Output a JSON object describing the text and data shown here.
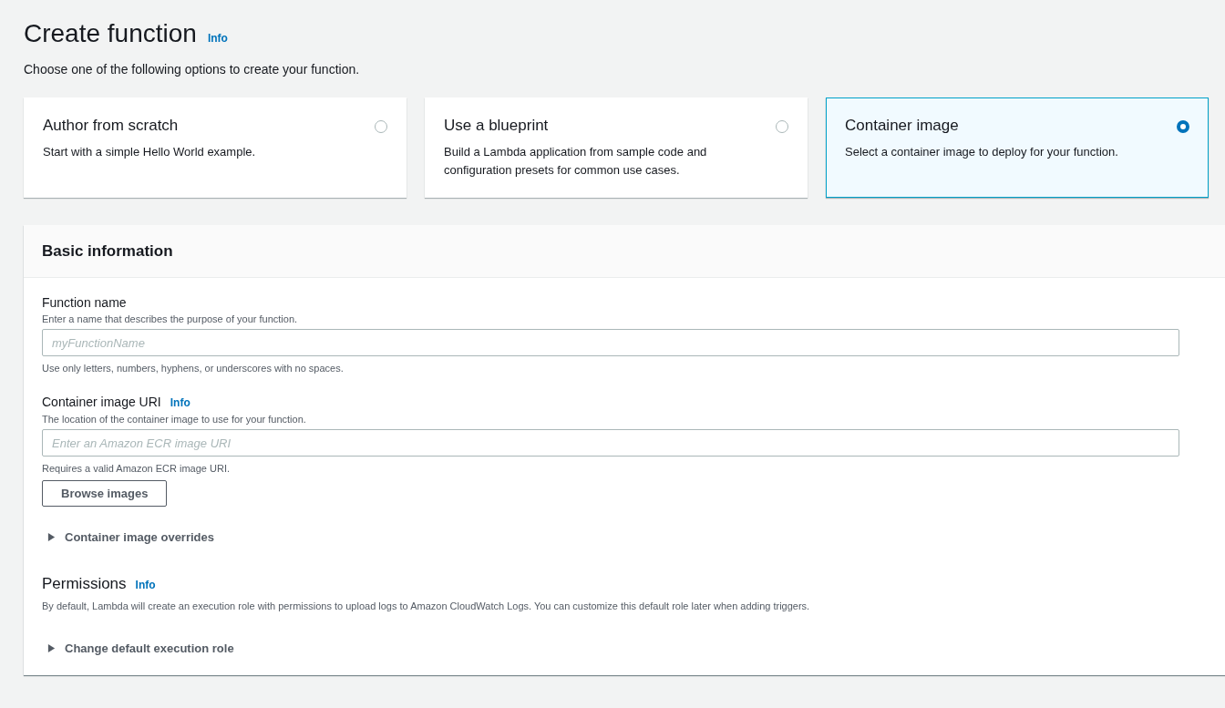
{
  "header": {
    "title": "Create function",
    "info_link": "Info",
    "description": "Choose one of the following options to create your function."
  },
  "options": [
    {
      "title": "Author from scratch",
      "description": "Start with a simple Hello World example.",
      "selected": false
    },
    {
      "title": "Use a blueprint",
      "description": "Build a Lambda application from sample code and configuration presets for common use cases.",
      "selected": false
    },
    {
      "title": "Container image",
      "description": "Select a container image to deploy for your function.",
      "selected": true
    }
  ],
  "basic_information": {
    "title": "Basic information",
    "items": [
      {
        "kind": "field",
        "label": "Function name",
        "description": "Enter a name that describes the purpose of your function.",
        "placeholder": "myFunctionName",
        "constraint": "Use only letters, numbers, hyphens, or underscores with no spaces."
      },
      {
        "kind": "field",
        "label": "Container image URI",
        "info_link": "Info",
        "description": "The location of the container image to use for your function.",
        "placeholder": "Enter an Amazon ECR image URI",
        "constraint": "Requires a valid Amazon ECR image URI."
      },
      {
        "kind": "button",
        "label": "Browse images"
      },
      {
        "kind": "expander",
        "label": "Container image overrides",
        "expanded": false
      },
      {
        "kind": "section",
        "label": "Permissions",
        "info_link": "Info",
        "description": "By default, Lambda will create an execution role with permissions to upload logs to Amazon CloudWatch Logs. You can customize this default role later when adding triggers."
      },
      {
        "kind": "expander",
        "label": "Change default execution role",
        "expanded": false
      }
    ]
  }
}
